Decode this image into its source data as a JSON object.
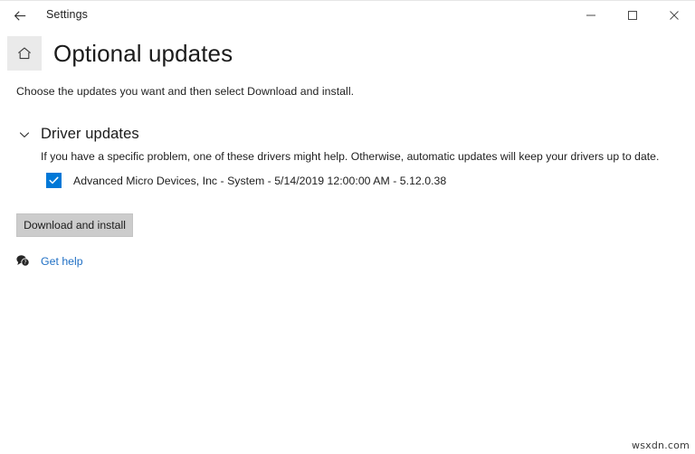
{
  "window": {
    "app_title": "Settings",
    "back_icon": "back-arrow-icon",
    "controls": {
      "minimize": "minimize-icon",
      "maximize": "maximize-icon",
      "close": "close-icon"
    }
  },
  "header": {
    "home_icon": "home-icon",
    "page_title": "Optional updates",
    "subtitle": "Choose the updates you want and then select Download and install."
  },
  "section": {
    "expander_icon": "chevron-down-icon",
    "title": "Driver updates",
    "description": "If you have a specific problem, one of these drivers might help. Otherwise, automatic updates will keep your drivers up to date.",
    "updates": [
      {
        "checked": true,
        "label": "Advanced Micro Devices, Inc - System - 5/14/2019 12:00:00 AM - 5.12.0.38"
      }
    ]
  },
  "actions": {
    "download_install_label": "Download and install"
  },
  "help": {
    "icon": "help-bubble-icon",
    "label": "Get help"
  },
  "watermark": "wsxdn.com",
  "colors": {
    "accent": "#0078d7",
    "link": "#1f6fc4",
    "button_fill": "#cccccc",
    "home_box": "#eaeaea"
  }
}
